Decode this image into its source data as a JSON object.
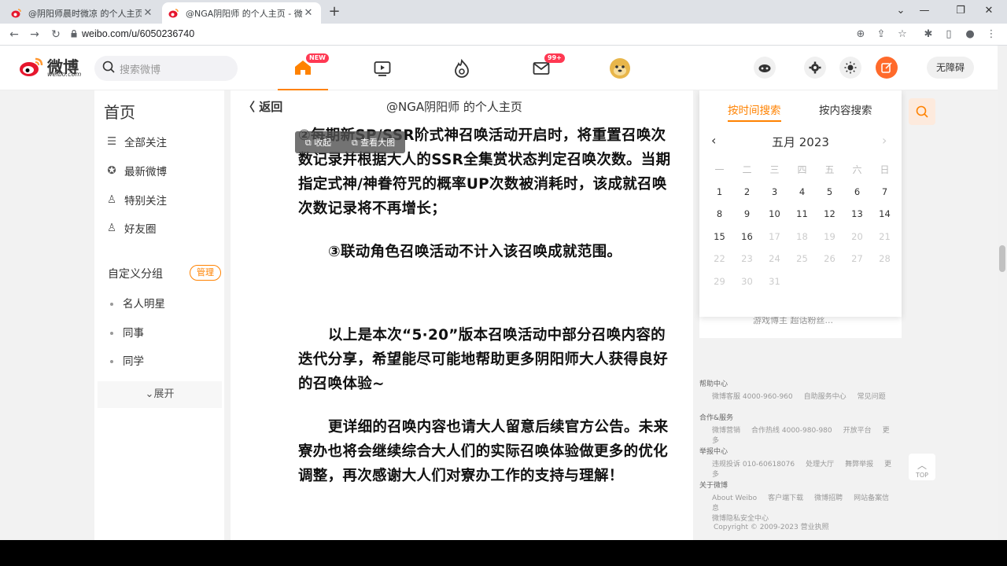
{
  "browser": {
    "tabs": [
      {
        "title": "@阴阳师晨时微凉 的个人主页 -",
        "close": "✕"
      },
      {
        "title": "@NGA阴阳师 的个人主页 - 微博",
        "close": "✕"
      }
    ],
    "new_tab": "+",
    "url": "weibo.com/u/6050236740"
  },
  "header": {
    "logo_text": "微博",
    "logo_sub": "weibo.com",
    "search_placeholder": "搜索微博",
    "new_badge": "NEW",
    "msg_badge": "99+",
    "accessibility": "无障碍"
  },
  "leftnav": {
    "home": "首页",
    "items": [
      {
        "label": "全部关注",
        "icon": "list-icon"
      },
      {
        "label": "最新微博",
        "icon": "star-circle-icon"
      },
      {
        "label": "特别关注",
        "icon": "user-star-icon"
      },
      {
        "label": "好友圈",
        "icon": "user-group-icon"
      }
    ],
    "custom_group": "自定义分组",
    "manage": "管理",
    "groups": [
      "名人明星",
      "同事",
      "同学"
    ],
    "expand": "展开"
  },
  "main": {
    "back": "返回",
    "title": "@NGA阴阳师 的个人主页",
    "toolbar": {
      "collapse": "收起",
      "view_large": "查看大图"
    },
    "paragraphs": [
      "②每期新SP/SSR阶式神召唤活动开启时，将重置召唤次数记录并根据大人的SSR全集赏状态判定召唤次数。当期指定式神/神眷符咒的概率UP次数被消耗时，该成就召唤次数记录将不再增长；",
      "③联动角色召唤活动不计入该召唤成就范围。",
      "以上是本次“5·20”版本召唤活动中部分召唤内容的迭代分享，希望能尽可能地帮助更多阴阳师大人获得良好的召唤体验~",
      "更详细的召唤内容也请大人留意后续官方公告。未来寮办也将会继续综合大人们的实际召唤体验做更多的优化调整，再次感谢大人们对寮办工作的支持与理解！"
    ]
  },
  "calendar": {
    "tab_time": "按时间搜索",
    "tab_content": "按内容搜索",
    "month": "五月 2023",
    "weekdays": [
      "一",
      "二",
      "三",
      "四",
      "五",
      "六",
      "日"
    ],
    "days": [
      "1",
      "2",
      "3",
      "4",
      "5",
      "6",
      "7",
      "8",
      "9",
      "10",
      "11",
      "12",
      "13",
      "14",
      "15",
      "16",
      "17",
      "18",
      "19",
      "20",
      "21",
      "22",
      "23",
      "24",
      "25",
      "26",
      "27",
      "28",
      "29",
      "30",
      "31"
    ],
    "enabled_through": 16
  },
  "right_card": {
    "text": "游戏博主 超话粉丝..."
  },
  "footer": {
    "help": {
      "title": "帮助中心",
      "links": [
        "微博客服 4000-960-960",
        "自助服务中心",
        "常见问题"
      ]
    },
    "coop": {
      "title": "合作&服务",
      "links": [
        "微博营销",
        "合作热线 4000-980-980",
        "开放平台",
        "更多"
      ]
    },
    "report": {
      "title": "举报中心",
      "links": [
        "违规投诉 010-60618076",
        "处理大厅",
        "舞弊举报",
        "更多"
      ]
    },
    "about": {
      "title": "关于微博",
      "links": [
        "About Weibo",
        "客户端下载",
        "微博招聘",
        "网站备案信息",
        "微博隐私安全中心"
      ]
    },
    "copyright": "Copyright © 2009-2023 营业执照"
  },
  "top_label": "TOP"
}
